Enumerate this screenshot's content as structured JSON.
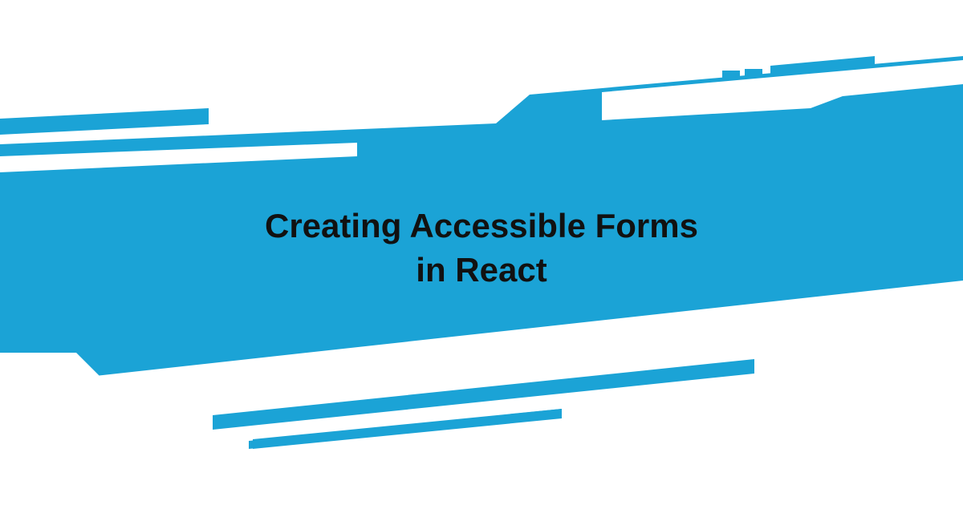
{
  "banner": {
    "title": "Creating Accessible Forms\nin React",
    "colors": {
      "accent": "#1BA3D6",
      "background": "#ffffff",
      "text": "#111111"
    }
  }
}
